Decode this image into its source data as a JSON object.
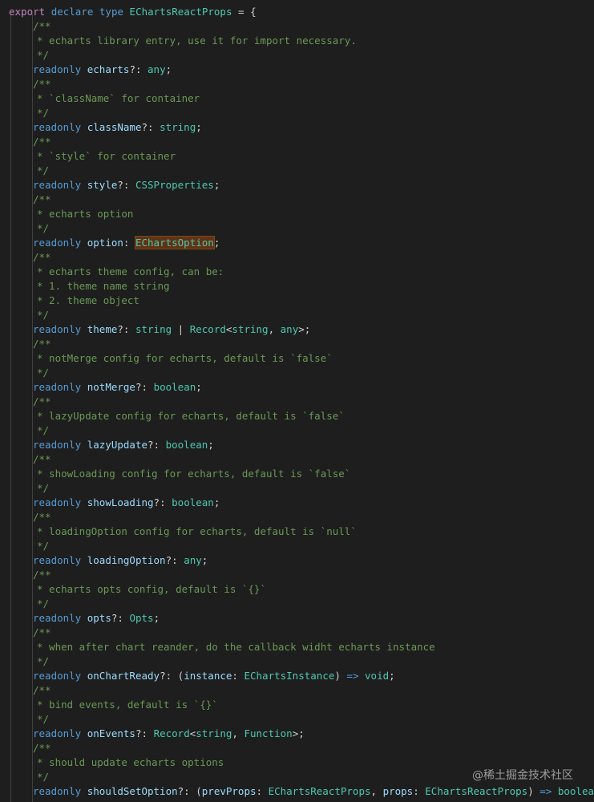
{
  "code": {
    "header": {
      "export_kw": "export",
      "declare_kw": "declare",
      "type_kw": "type",
      "type_name": "EChartsReactProps",
      "eq": "=",
      "brace": "{"
    },
    "comment_open": "/**",
    "comment_close": "*/",
    "readonly_kw": "readonly",
    "fields": [
      {
        "comment": [
          "* echarts library entry, use it for import necessary."
        ],
        "name": "echarts",
        "sep": "?:",
        "type": "any",
        "end": ";"
      },
      {
        "comment": [
          "* `className` for container"
        ],
        "name": "className",
        "sep": "?:",
        "type": "string",
        "end": ";"
      },
      {
        "comment": [
          "* `style` for container"
        ],
        "name": "style",
        "sep": "?:",
        "type": "CSSProperties",
        "end": ";"
      },
      {
        "comment": [
          "* echarts option"
        ],
        "name": "option",
        "sep": ":",
        "type": "EChartsOption",
        "end": ";"
      },
      {
        "comment": [
          "* echarts theme config, can be:",
          "* 1. theme name string",
          "* 2. theme object"
        ],
        "name": "theme",
        "sep": "?:",
        "type_parts": [
          "string",
          "|",
          "Record",
          "<",
          "string",
          ",",
          "any",
          ">"
        ],
        "end": ";"
      },
      {
        "comment": [
          "* notMerge config for echarts, default is `false`"
        ],
        "name": "notMerge",
        "sep": "?:",
        "type": "boolean",
        "end": ";"
      },
      {
        "comment": [
          "* lazyUpdate config for echarts, default is `false`"
        ],
        "name": "lazyUpdate",
        "sep": "?:",
        "type": "boolean",
        "end": ";"
      },
      {
        "comment": [
          "* showLoading config for echarts, default is `false`"
        ],
        "name": "showLoading",
        "sep": "?:",
        "type": "boolean",
        "end": ";"
      },
      {
        "comment": [
          "* loadingOption config for echarts, default is `null`"
        ],
        "name": "loadingOption",
        "sep": "?:",
        "type": "any",
        "end": ";"
      },
      {
        "comment": [
          "* echarts opts config, default is `{}`"
        ],
        "name": "opts",
        "sep": "?:",
        "type": "Opts",
        "end": ";"
      },
      {
        "comment": [
          "* when after chart reander, do the callback widht echarts instance"
        ],
        "name": "onChartReady",
        "sep": "?:",
        "sig": {
          "open": "(",
          "param": "instance",
          "colon": ":",
          "param_type": "EChartsInstance",
          "close": ")",
          "arrow": "=>",
          "ret": "void"
        },
        "end": ";"
      },
      {
        "comment": [
          "* bind events, default is `{}`"
        ],
        "name": "onEvents",
        "sep": "?:",
        "type_parts": [
          "Record",
          "<",
          "string",
          ",",
          "Function",
          ">"
        ],
        "end": ";"
      },
      {
        "comment": [
          "* should update echarts options"
        ],
        "name": "shouldSetOption",
        "sep": "?:",
        "sig2": {
          "open": "(",
          "p1": "prevProps",
          "c1": ":",
          "t1": "EChartsReactProps",
          "comma": ",",
          "p2": "props",
          "c2": ":",
          "t2": "EChartsReactProps",
          "close": ")",
          "arrow": "=>",
          "ret": "boolean"
        },
        "end": ";"
      }
    ]
  },
  "watermark": "@稀土掘金技术社区",
  "colors": {
    "background": "#1e1e1e",
    "keyword": "#569cd6",
    "type": "#4ec9b0",
    "property": "#9cdcfe",
    "comment": "#6a9955",
    "highlight": "#613214"
  }
}
